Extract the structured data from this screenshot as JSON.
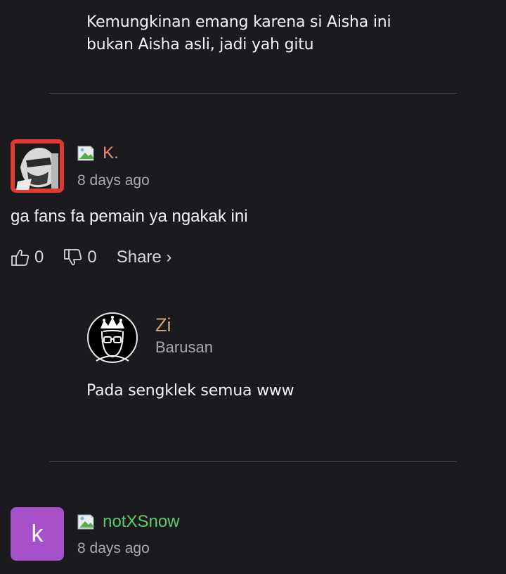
{
  "reply_top": {
    "text_line1": "Kemungkinan emang karena si Aisha ini",
    "text_line2": "bukan Aisha asli, jadi yah gitu"
  },
  "comment1": {
    "username": "K.",
    "username_color": "#f08a74",
    "timestamp": "8 days ago",
    "text": "ga fans fa pemain ya ngakak ini",
    "like_count": "0",
    "dislike_count": "0",
    "share_label": "Share ›"
  },
  "reply_zi": {
    "username": "Zi",
    "username_color": "#c9a27a",
    "timestamp": "Barusan",
    "text": "Pada sengklek semua www"
  },
  "comment2": {
    "avatar_letter": "k",
    "avatar_color": "#a54fc9",
    "username": "notXSnow",
    "username_color": "#5cc96a",
    "timestamp": "8 days ago"
  },
  "icons": [
    "thumbs-up-icon",
    "thumbs-down-icon",
    "broken-image-icon",
    "crown-avatar-icon"
  ]
}
